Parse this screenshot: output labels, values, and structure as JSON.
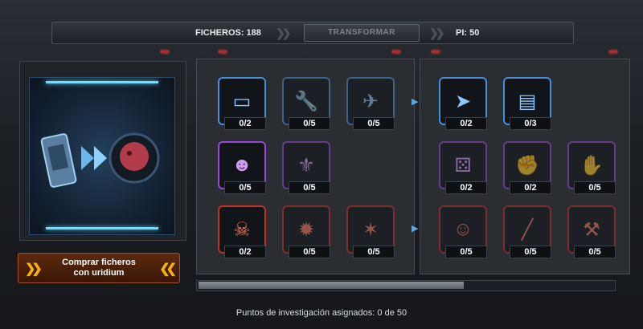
{
  "header": {
    "files_label": "FICHEROS: 188",
    "transform_label": "TRANSFORMAR",
    "pi_label": "PI: 50"
  },
  "left_panel": {
    "buy_button_line1": "Comprar ficheros",
    "buy_button_line2": "con uridium"
  },
  "footer": {
    "assigned_label": "Puntos de investigación asignados: 0 de 50"
  },
  "skill_grid_left": [
    [
      {
        "icon": "ship-module-icon",
        "color": "blue",
        "count": "0/2"
      },
      {
        "icon": "wrench-icon",
        "color": "blue",
        "count": "0/5",
        "dim": true
      },
      {
        "icon": "fighter-ship-icon",
        "color": "blue",
        "count": "0/5",
        "dim": true
      }
    ],
    [
      {
        "icon": "soldier-portrait-icon",
        "color": "purple",
        "count": "0/5"
      },
      {
        "icon": "claw-emblem-icon",
        "color": "purple",
        "count": "0/5",
        "dim": true
      },
      null
    ],
    [
      {
        "icon": "skull-emblem-icon",
        "color": "red",
        "count": "0/2"
      },
      {
        "icon": "explosion-icon",
        "color": "red",
        "count": "0/5",
        "dim": true
      },
      {
        "icon": "red-shuriken-icon",
        "color": "red",
        "count": "0/5",
        "dim": true
      }
    ]
  ],
  "skill_grid_right": [
    [
      {
        "icon": "cruiser-icon",
        "color": "blue",
        "count": "0/2"
      },
      {
        "icon": "cargo-module-icon",
        "color": "blue",
        "count": "0/3"
      },
      null
    ],
    [
      {
        "icon": "dice-icon",
        "color": "purple",
        "count": "0/2",
        "dim": true
      },
      {
        "icon": "fist-icon",
        "color": "purple",
        "count": "0/2",
        "dim": true
      },
      {
        "icon": "magic-hand-icon",
        "color": "purple",
        "count": "0/5",
        "dim": true
      }
    ],
    [
      {
        "icon": "warrior-portrait-icon",
        "color": "red",
        "count": "0/5",
        "dim": true
      },
      {
        "icon": "rifle-icon",
        "color": "red",
        "count": "0/5",
        "dim": true
      },
      {
        "icon": "axe-icon",
        "color": "red",
        "count": "0/5",
        "dim": true
      }
    ]
  ]
}
